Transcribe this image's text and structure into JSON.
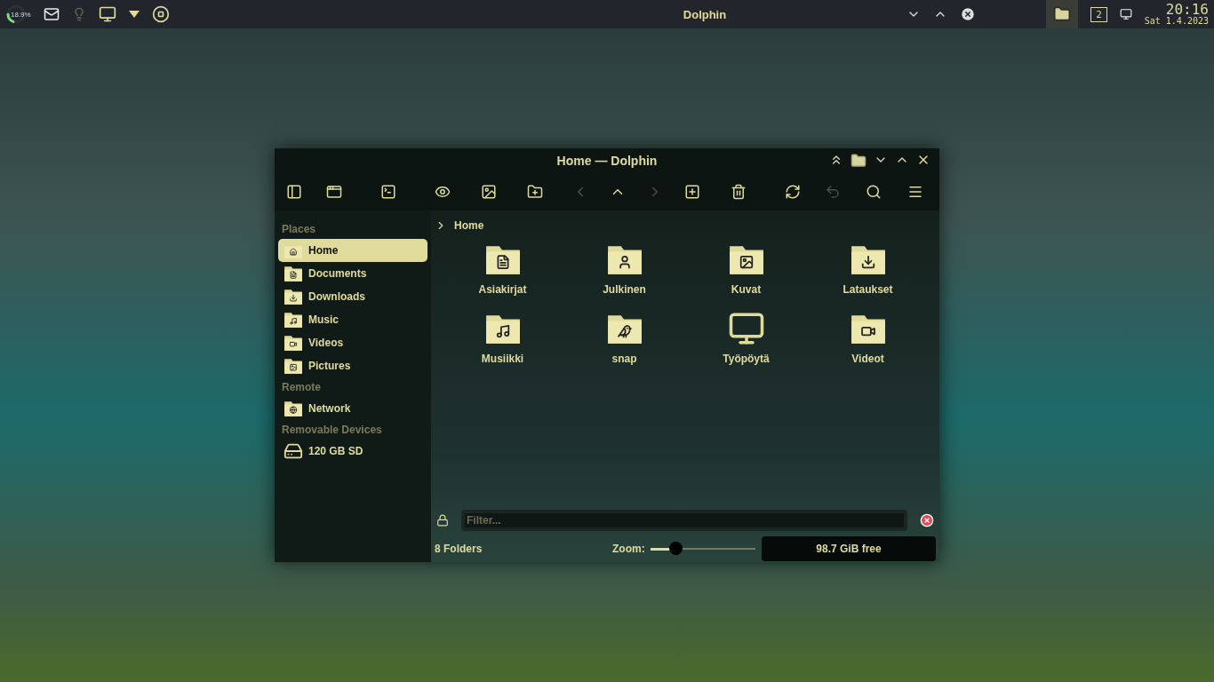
{
  "panel": {
    "battery": {
      "reading": "18.9%",
      "level": 0.189
    },
    "title": "Dolphin",
    "pager": "2",
    "time": "20:16",
    "date": "Sat 1.4.2023"
  },
  "window": {
    "title": "Home — Dolphin",
    "toolbar": [
      {
        "disabled": false
      },
      {
        "disabled": false
      },
      {
        "disabled": false
      },
      {
        "disabled": false
      },
      {
        "disabled": false
      },
      {
        "disabled": false
      },
      {
        "disabled": true
      },
      {
        "disabled": false
      },
      {
        "disabled": true
      },
      {
        "disabled": false
      },
      {
        "disabled": false
      },
      {
        "disabled": false
      },
      {
        "disabled": true
      },
      {
        "disabled": false
      },
      {
        "disabled": false
      }
    ],
    "sidebar": [
      {
        "heading": "Places",
        "items": [
          {
            "label": "Home",
            "kind": "home",
            "selected": true
          },
          {
            "label": "Documents",
            "kind": "document",
            "selected": false
          },
          {
            "label": "Downloads",
            "kind": "download",
            "selected": false
          },
          {
            "label": "Music",
            "kind": "music",
            "selected": false
          },
          {
            "label": "Videos",
            "kind": "video",
            "selected": false
          },
          {
            "label": "Pictures",
            "kind": "picture",
            "selected": false
          }
        ]
      },
      {
        "heading": "Remote",
        "items": [
          {
            "label": "Network",
            "kind": "network",
            "selected": false
          }
        ]
      },
      {
        "heading": "Removable Devices",
        "items": [
          {
            "label": "120 GB SD",
            "kind": "sd",
            "selected": false
          }
        ]
      }
    ],
    "breadcrumb": "Home",
    "files": [
      {
        "name": "Asiakirjat",
        "kind": "document"
      },
      {
        "name": "Julkinen",
        "kind": "user"
      },
      {
        "name": "Kuvat",
        "kind": "picture"
      },
      {
        "name": "Lataukset",
        "kind": "download"
      },
      {
        "name": "Musiikki",
        "kind": "music"
      },
      {
        "name": "snap",
        "kind": "snap"
      },
      {
        "name": "Työpöytä",
        "kind": "desktop"
      },
      {
        "name": "Videot",
        "kind": "video"
      }
    ],
    "filter": {
      "placeholder": "Filter..."
    },
    "status": {
      "count": "8 Folders",
      "zoom_label": "Zoom:",
      "zoom": {
        "level": 0.2
      },
      "free": "98.7 GiB free"
    }
  }
}
